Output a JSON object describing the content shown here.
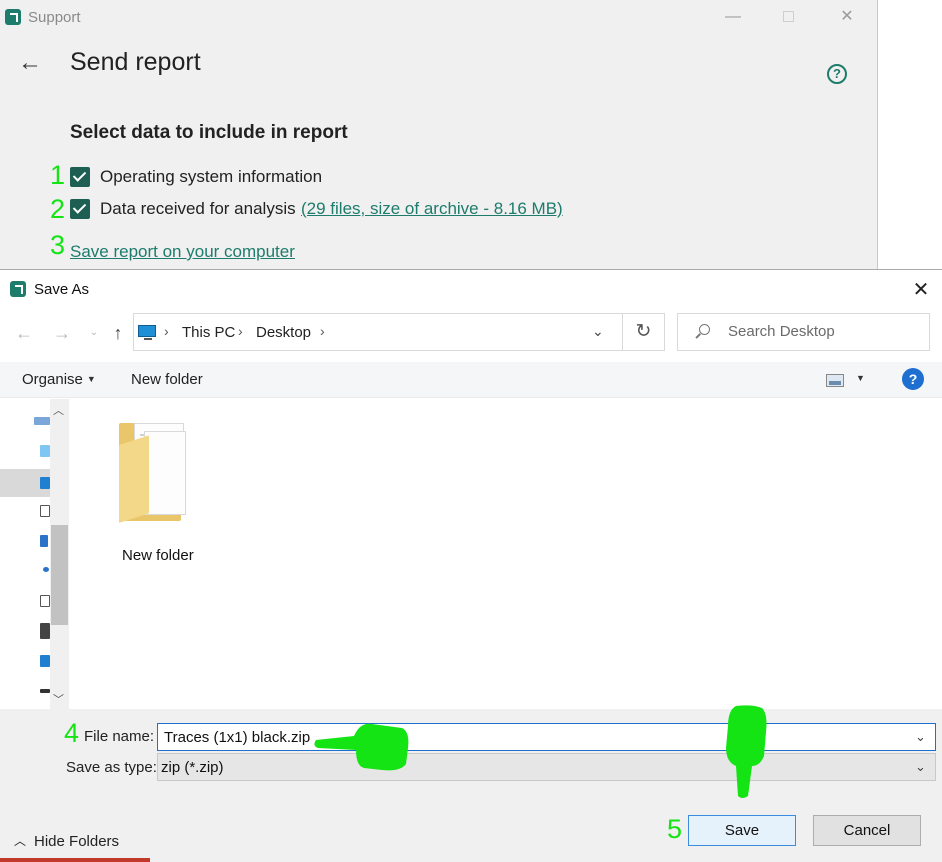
{
  "support_window": {
    "title": "Support",
    "page_title": "Send report",
    "section_title": "Select data to include in report",
    "options": [
      {
        "step": "1",
        "label": "Operating system information",
        "checked": true
      },
      {
        "step": "2",
        "label": "Data received for analysis",
        "link": "(29 files, size of archive - 8.16 MB)",
        "checked": true
      }
    ],
    "save_step": "3",
    "save_link": "Save report on your computer",
    "accent_color": "#1d7c6c"
  },
  "save_dialog": {
    "title": "Save As",
    "breadcrumb": [
      "This PC",
      "Desktop"
    ],
    "search_placeholder": "Search Desktop",
    "toolbar": {
      "organise": "Organise",
      "new_folder": "New folder"
    },
    "items": [
      {
        "name": "New folder",
        "icon": "folder-icon"
      }
    ],
    "file_name_step": "4",
    "file_name_label": "File name:",
    "file_name_value": "Traces (1x1) black.zip",
    "save_type_label": "Save as type:",
    "save_type_value": "zip (*.zip)",
    "hide_folders": "Hide Folders",
    "save_step": "5",
    "save_button": "Save",
    "cancel_button": "Cancel"
  },
  "annotation_color": "#14e314"
}
